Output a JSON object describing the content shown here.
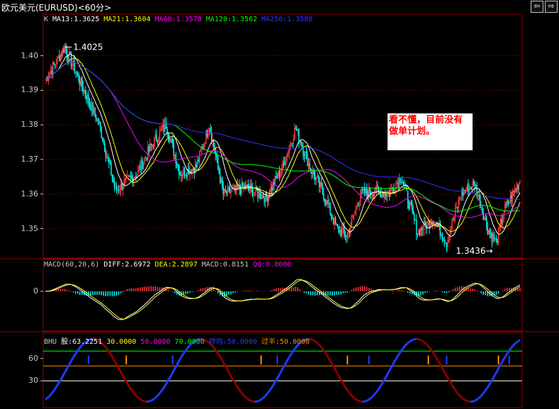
{
  "window": {
    "title": "欧元美元(EURUSD)<60分>"
  },
  "toolbar": {
    "prev_icon": "arrow-left-icon",
    "next_icon": "arrow-right-icon",
    "prev_label": "⇦",
    "next_label": "⇨"
  },
  "colors": {
    "grid": "#8b0000",
    "up": "#ff3c3c",
    "down": "#00ffff",
    "ma13": "#ffffff",
    "ma21": "#ffff00",
    "ma60": "#ff00ff",
    "ma120": "#00ff00",
    "ma250": "#3232ff"
  },
  "main_panel": {
    "legend": [
      {
        "text": "K",
        "color": "#c8c8c8"
      },
      {
        "text": "MA13:1.3625",
        "color": "#ffffff"
      },
      {
        "text": "MA21:1.3604",
        "color": "#ffff00"
      },
      {
        "text": "MA60:1.3578",
        "color": "#ff00ff"
      },
      {
        "text": "MA120:1.3562",
        "color": "#00ff00"
      },
      {
        "text": "MA250:1.3580",
        "color": "#3232ff"
      }
    ],
    "high_label": "1.4025",
    "low_label": "1.3436→",
    "note": "看不懂，目前没有做单计划。"
  },
  "macd_panel": {
    "legend": [
      {
        "text": "MACD(60,20,6)",
        "color": "#c8c8c8"
      },
      {
        "text": "DIFF:2.6972",
        "color": "#ffffff"
      },
      {
        "text": "DEA:2.2897",
        "color": "#ffff00"
      },
      {
        "text": "MACD:0.8151",
        "color": "#c8c8c8"
      },
      {
        "text": "QQ:0.0000",
        "color": "#ff00ff"
      }
    ]
  },
  "bhu_panel": {
    "legend": [
      {
        "text": "BHU",
        "color": "#c8c8c8"
      },
      {
        "text": "股:63.2251",
        "color": "#ffffff"
      },
      {
        "text": "30.0000",
        "color": "#ffff00"
      },
      {
        "text": "50.0000",
        "color": "#ff00ff"
      },
      {
        "text": "70.0000",
        "color": "#00ff00"
      },
      {
        "text": "转向:50.0000",
        "color": "#3232ff"
      },
      {
        "text": "过半:50.0000",
        "color": "#ff8c00"
      }
    ]
  },
  "chart_data": {
    "type": "candlestick",
    "y_ticks": [
      "1.40",
      "1.39",
      "1.38",
      "1.37",
      "1.36",
      "1.35"
    ],
    "ylim": [
      1.3415,
      1.412
    ],
    "grid": true,
    "macd_ticks": [
      "0"
    ],
    "bhu_ticks": [
      "60",
      "30"
    ],
    "bhu_ylim": [
      0,
      100
    ],
    "bhu_levels": [
      30,
      50,
      70
    ],
    "key_points": [
      {
        "x": 0,
        "close": 1.393
      },
      {
        "x": 18,
        "close": 1.4025
      },
      {
        "x": 50,
        "close": 1.38
      },
      {
        "x": 65,
        "close": 1.361
      },
      {
        "x": 85,
        "close": 1.366
      },
      {
        "x": 100,
        "close": 1.375
      },
      {
        "x": 112,
        "close": 1.38
      },
      {
        "x": 125,
        "close": 1.366
      },
      {
        "x": 140,
        "close": 1.368
      },
      {
        "x": 152,
        "close": 1.38
      },
      {
        "x": 165,
        "close": 1.36
      },
      {
        "x": 185,
        "close": 1.362
      },
      {
        "x": 205,
        "close": 1.359
      },
      {
        "x": 220,
        "close": 1.368
      },
      {
        "x": 232,
        "close": 1.379
      },
      {
        "x": 245,
        "close": 1.368
      },
      {
        "x": 258,
        "close": 1.36
      },
      {
        "x": 270,
        "close": 1.35
      },
      {
        "x": 280,
        "close": 1.348
      },
      {
        "x": 292,
        "close": 1.36
      },
      {
        "x": 305,
        "close": 1.361
      },
      {
        "x": 318,
        "close": 1.36
      },
      {
        "x": 330,
        "close": 1.365
      },
      {
        "x": 345,
        "close": 1.349
      },
      {
        "x": 360,
        "close": 1.353
      },
      {
        "x": 372,
        "close": 1.346
      },
      {
        "x": 385,
        "close": 1.36
      },
      {
        "x": 398,
        "close": 1.363
      },
      {
        "x": 410,
        "close": 1.35
      },
      {
        "x": 418,
        "close": 1.346
      },
      {
        "x": 425,
        "close": 1.355
      },
      {
        "x": 440,
        "close": 1.364
      }
    ]
  }
}
